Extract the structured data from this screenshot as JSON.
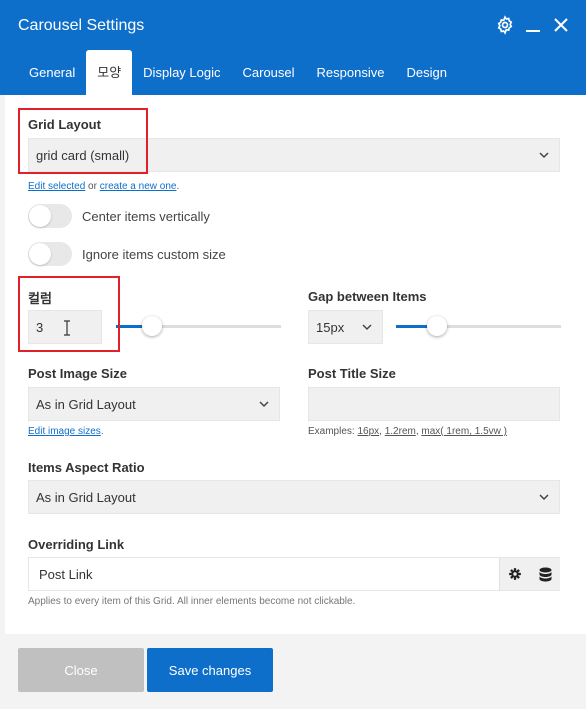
{
  "header": {
    "title": "Carousel Settings",
    "icons": [
      "gear-icon",
      "minimize-icon",
      "close-icon"
    ]
  },
  "tabs": [
    {
      "label": "General",
      "active": false
    },
    {
      "label": "모양",
      "active": true
    },
    {
      "label": "Display Logic",
      "active": false
    },
    {
      "label": "Carousel",
      "active": false
    },
    {
      "label": "Responsive",
      "active": false
    },
    {
      "label": "Design",
      "active": false
    }
  ],
  "grid_layout": {
    "label": "Grid Layout",
    "value": "grid card (small)",
    "edit_link": "Edit selected",
    "or_text": "or",
    "create_link": "create a new one",
    "period": "."
  },
  "toggles": {
    "center_vertically": {
      "label": "Center items vertically",
      "on": false
    },
    "ignore_custom_size": {
      "label": "Ignore items custom size",
      "on": false
    }
  },
  "columns": {
    "label": "컬럼",
    "value": "3",
    "slider_fraction": 0.22
  },
  "gap": {
    "label": "Gap between Items",
    "value": "15px",
    "slider_fraction": 0.25
  },
  "post_image_size": {
    "label": "Post Image Size",
    "value": "As in Grid Layout",
    "edit_link": "Edit image sizes",
    "period": "."
  },
  "post_title_size": {
    "label": "Post Title Size",
    "value": "",
    "examples_prefix": "Examples:",
    "examples": [
      "16px",
      "1.2rem",
      "max( 1rem, 1.5vw )"
    ]
  },
  "aspect_ratio": {
    "label": "Items Aspect Ratio",
    "value": "As in Grid Layout"
  },
  "overriding_link": {
    "label": "Overriding Link",
    "value": "Post Link",
    "hint": "Applies to every item of this Grid. All inner elements become not clickable."
  },
  "footer": {
    "close_label": "Close",
    "save_label": "Save changes"
  },
  "colors": {
    "accent": "#0e6fcb",
    "highlight_box": "#e0202a",
    "close_button": "#c0c0c0"
  }
}
